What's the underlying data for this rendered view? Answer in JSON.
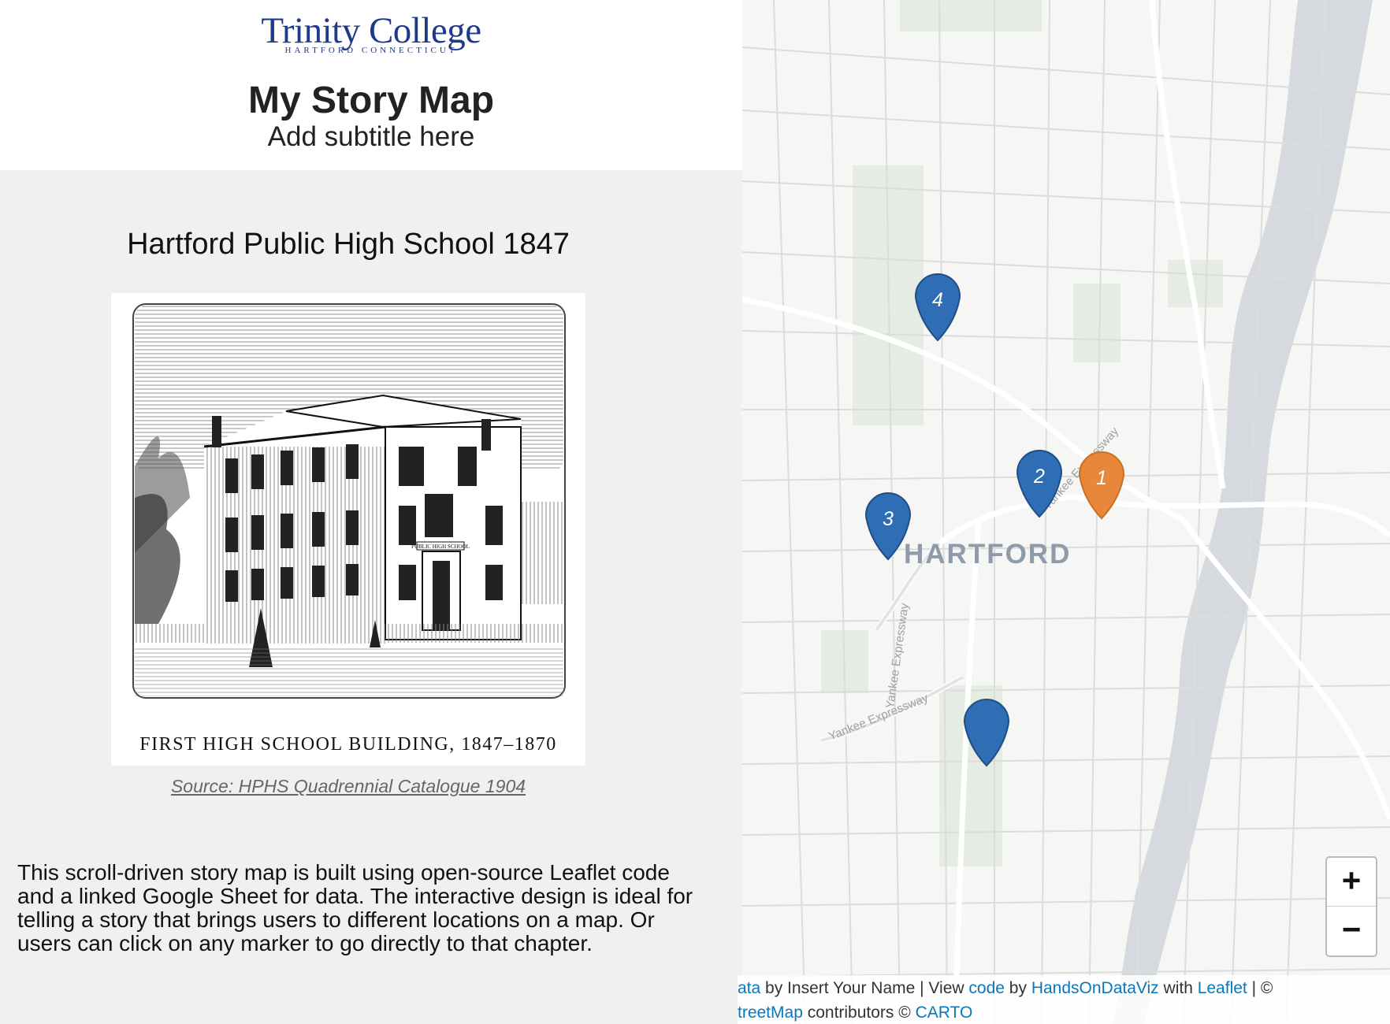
{
  "header": {
    "logo_text": "Trinity College",
    "logo_subtext": "HARTFORD CONNECTICUT",
    "title": "My Story Map",
    "subtitle": "Add subtitle here"
  },
  "chapter": {
    "title": "Hartford Public High School 1847",
    "image_caption": "FIRST HIGH SCHOOL BUILDING, 1847–1870",
    "image_sign": "PUBLIC HIGH SCHOOL",
    "source": "Source: HPHS Quadrennial Catalogue 1904",
    "description": "This scroll-driven story map is built using open-source Leaflet code and a linked Google Sheet for data. The interactive design is ideal for telling a story that brings users to different locations on a map. Or users can click on any marker to go directly to that chapter."
  },
  "map": {
    "city_label": "HARTFORD",
    "road_labels": [
      "Yankee Expressway",
      "Yankee Expressway",
      "Yankee Expressway"
    ],
    "markers": [
      {
        "label": "1",
        "color": "#e8873a",
        "active": true
      },
      {
        "label": "2",
        "color": "#2f6db5",
        "active": false
      },
      {
        "label": "3",
        "color": "#2f6db5",
        "active": false
      },
      {
        "label": "4",
        "color": "#2f6db5",
        "active": false
      },
      {
        "label": "",
        "color": "#2f6db5",
        "active": false
      }
    ],
    "zoom_in": "+",
    "zoom_out": "−",
    "colors": {
      "river": "#d6dadf",
      "park": "#e4ece3",
      "road": "#ffffff",
      "street": "#dddddd"
    }
  },
  "attribution": {
    "line1": [
      {
        "text": "ata",
        "link": true
      },
      {
        "text": " by Insert Your Name | View ",
        "link": false
      },
      {
        "text": "code",
        "link": true
      },
      {
        "text": " by ",
        "link": false
      },
      {
        "text": "HandsOnDataViz",
        "link": true
      },
      {
        "text": " with ",
        "link": false
      },
      {
        "text": "Leaflet",
        "link": true
      },
      {
        "text": " | ©",
        "link": false
      }
    ],
    "line2": [
      {
        "text": "treetMap",
        "link": true
      },
      {
        "text": " contributors © ",
        "link": false
      },
      {
        "text": "CARTO",
        "link": true
      }
    ]
  }
}
